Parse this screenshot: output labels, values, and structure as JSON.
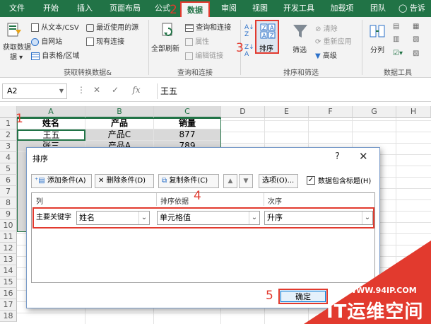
{
  "ribbon_tabs": [
    "文件",
    "开始",
    "插入",
    "页面布局",
    "公式",
    "数据",
    "审阅",
    "视图",
    "开发工具",
    "加载项",
    "团队",
    "告诉"
  ],
  "tell_me_icon": "lightbulb-icon",
  "ribbon": {
    "get_data_label": "获取数据",
    "get_data_sub": "据 ▾",
    "from_text": "从文本/CSV",
    "from_web": "自网站",
    "from_table": "自表格/区域",
    "recent_sources": "最近使用的源",
    "existing_conn": "现有连接",
    "group_get": "获取转换数据&",
    "refresh_all": "全部刷新",
    "queries_conn": "查询和连接",
    "properties": "属性",
    "edit_links": "编辑链接",
    "group_queries": "查询和连接",
    "sort_label": "排序",
    "filter_label": "筛选",
    "clear": "清除",
    "reapply": "重新应用",
    "advanced": "高级",
    "group_sort": "排序和筛选",
    "split": "分列",
    "group_tools": "数据工具"
  },
  "formula_bar": {
    "name_box": "A2",
    "fx": "fx",
    "value": "王五"
  },
  "columns": [
    "A",
    "B",
    "C",
    "D",
    "E",
    "F",
    "G",
    "H"
  ],
  "rows": [
    "1",
    "2",
    "3",
    "4",
    "5",
    "6",
    "7",
    "8",
    "9",
    "10",
    "11",
    "12",
    "13",
    "14",
    "15",
    "16",
    "17",
    "18"
  ],
  "table": {
    "headers": [
      "姓名",
      "产品",
      "销量"
    ],
    "row2": [
      "王五",
      "产品C",
      "877"
    ],
    "row3": [
      "张三",
      "产品A",
      "789"
    ]
  },
  "annotations": [
    "1",
    "2",
    "3",
    "4",
    "5"
  ],
  "dialog": {
    "title": "排序",
    "help": "?",
    "close": "✕",
    "add_level": "添加条件(A)",
    "delete_level": "删除条件(D)",
    "copy_level": "复制条件(C)",
    "move_up": "▲",
    "move_down": "▼",
    "options": "选项(O)...",
    "has_headers": "数据包含标题(H)",
    "has_headers_checked": true,
    "col_header": "列",
    "sorton_header": "排序依据",
    "order_header": "次序",
    "primary_key_label": "主要关键字",
    "column_value": "姓名",
    "sort_on_value": "单元格值",
    "order_value": "升序",
    "ok": "确定"
  },
  "watermark": {
    "url": "WWW.94IP.COM",
    "brand": "IT运维空间"
  },
  "colors": {
    "excel_green": "#217346",
    "highlight_red": "#e23a2e"
  }
}
